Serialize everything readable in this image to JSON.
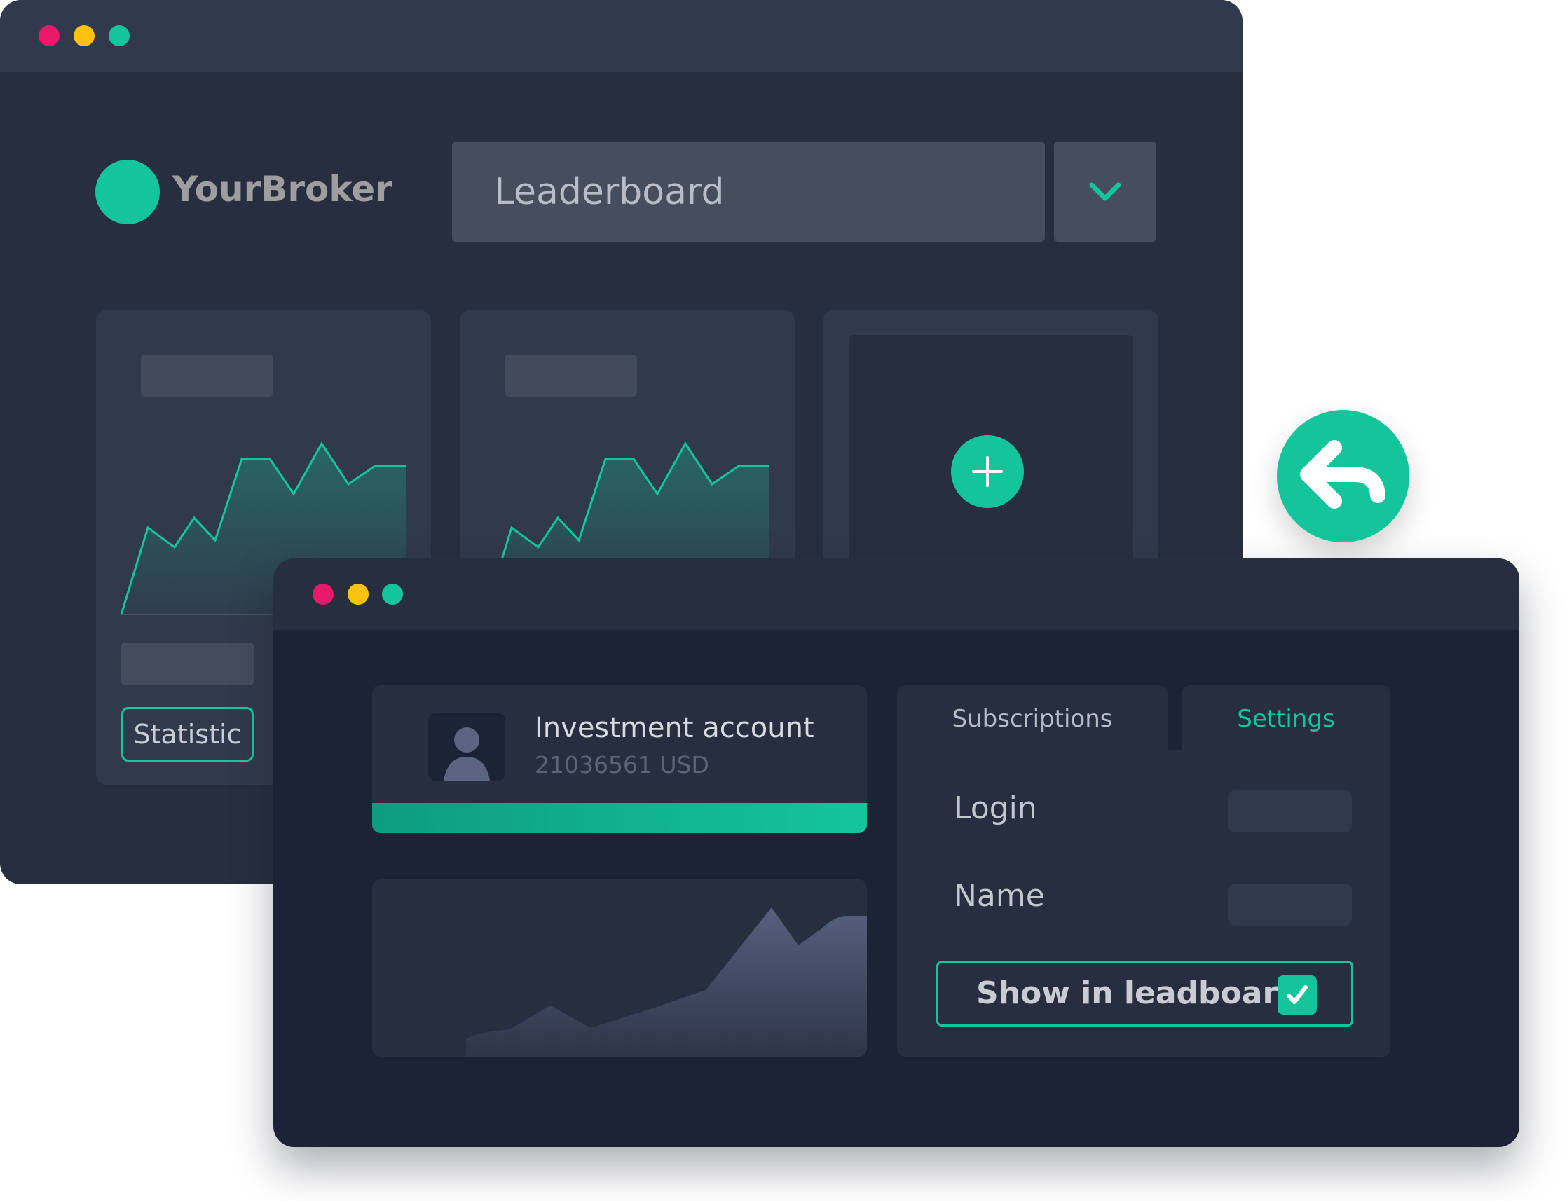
{
  "colors": {
    "accent": "#14c59c",
    "window_back": "#262e40",
    "window_front": "#1c2336",
    "dot_red": "#e8186a",
    "dot_yellow": "#fcc20f",
    "dot_green": "#14c59c"
  },
  "back_window": {
    "brand": {
      "name": "YourBroker",
      "logo": "brand-circle-logo"
    },
    "leaderboard_select": {
      "value": "Leaderboard",
      "toggle_icon": "chevron-down-icon"
    },
    "cards": [
      {
        "title_placeholder": true,
        "chart": "area-sparkline",
        "button_label": "Statistic"
      },
      {
        "title_placeholder": true,
        "chart": "area-sparkline"
      },
      {
        "action_icon": "plus-icon"
      }
    ]
  },
  "back_badge": {
    "icon": "reply-arrow-icon"
  },
  "front_window": {
    "account": {
      "avatar_icon": "user-icon",
      "title": "Investment account",
      "number": "21036561 USD",
      "progress": 1.0
    },
    "mini_chart": {
      "icon": "area-chart"
    },
    "tabs": [
      {
        "label": "Subscriptions",
        "active": false
      },
      {
        "label": "Settings",
        "active": true
      }
    ],
    "settings": {
      "login_label": "Login",
      "name_label": "Name",
      "show_in_leaderboard": {
        "label": "Show in leadboard",
        "checked": true,
        "icon": "check-icon"
      }
    }
  }
}
